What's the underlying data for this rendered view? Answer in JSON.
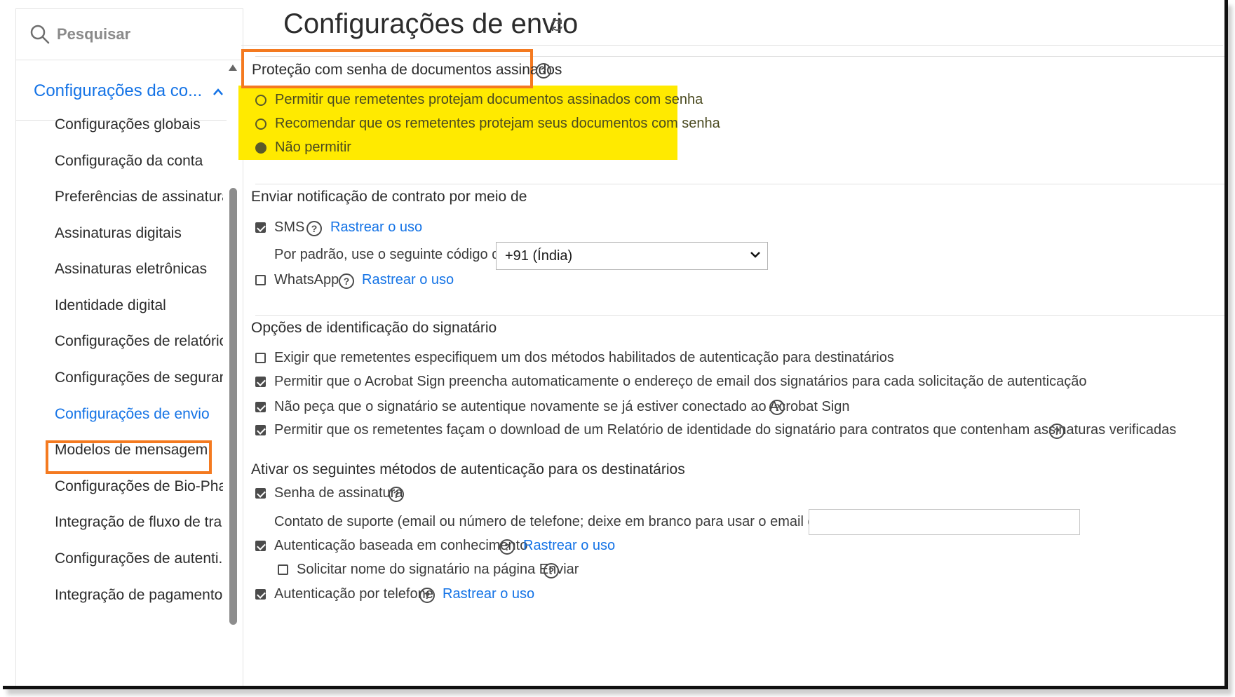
{
  "search": {
    "placeholder": "Pesquisar"
  },
  "sidebar": {
    "group_title": "Configurações da co...",
    "items": [
      {
        "label": "Configurações globais"
      },
      {
        "label": "Configuração da conta"
      },
      {
        "label": "Preferências de assinatura"
      },
      {
        "label": "Assinaturas digitais"
      },
      {
        "label": "Assinaturas eletrônicas"
      },
      {
        "label": "Identidade digital"
      },
      {
        "label": "Configurações de relatório"
      },
      {
        "label": "Configurações de seguran..."
      },
      {
        "label": "Configurações de envio",
        "active": true
      },
      {
        "label": "Modelos de mensagem"
      },
      {
        "label": "Configurações de Bio-Pha..."
      },
      {
        "label": "Integração de fluxo de tra..."
      },
      {
        "label": "Configurações de autenti..."
      },
      {
        "label": "Integração de pagamento"
      }
    ]
  },
  "main": {
    "title": "Configurações de envio",
    "password_protection": {
      "title": "Proteção com senha de documentos assinados",
      "options": [
        {
          "label": "Permitir que remetentes protejam documentos assinados com senha",
          "selected": false
        },
        {
          "label": "Recomendar que os remetentes protejam seus documentos com senha",
          "selected": false
        },
        {
          "label": "Não permitir",
          "selected": true
        }
      ]
    },
    "notification": {
      "title": "Enviar notificação de contrato por meio de",
      "sms_label": "SMS",
      "sms_checked": true,
      "track_usage": "Rastrear o uso",
      "country_label": "Por padrão, use o seguinte código de país:",
      "country_value": "+91 (Índia)",
      "whatsapp_label": "WhatsApp",
      "whatsapp_checked": false
    },
    "signer_identification": {
      "title": "Opções de identificação do signatário",
      "options": [
        {
          "label": "Exigir que remetentes especifiquem um dos métodos habilitados de autenticação para destinatários",
          "checked": false
        },
        {
          "label": "Permitir que o Acrobat Sign preencha automaticamente o endereço de email dos signatários para cada solicitação de autenticação",
          "checked": true
        },
        {
          "label": "Não peça que o signatário se autentique novamente se já estiver conectado ao Acrobat Sign",
          "checked": true
        },
        {
          "label": "Permitir que os remetentes façam o download de um Relatório de identidade do signatário para contratos que contenham assinaturas verificadas",
          "checked": true
        }
      ]
    },
    "auth_methods": {
      "title": "Ativar os seguintes métodos de autenticação para os destinatários",
      "signing_password": "Senha de assinatura",
      "support_contact": "Contato de suporte (email ou número de telefone; deixe em branco para usar o email do remetente):",
      "kba": "Autenticação baseada em conhecimento",
      "request_signer_name": "Solicitar nome do signatário na página Enviar",
      "phone_auth": "Autenticação por telefone",
      "track_usage": "Rastrear o uso"
    }
  },
  "colors": {
    "accent": "#1473e6",
    "highlight_border": "#f47a20",
    "highlight_fill": "#ffea00"
  },
  "icons": [
    "search-icon",
    "chevron-up-icon",
    "refresh-icon",
    "help-icon",
    "chevron-down-icon"
  ]
}
